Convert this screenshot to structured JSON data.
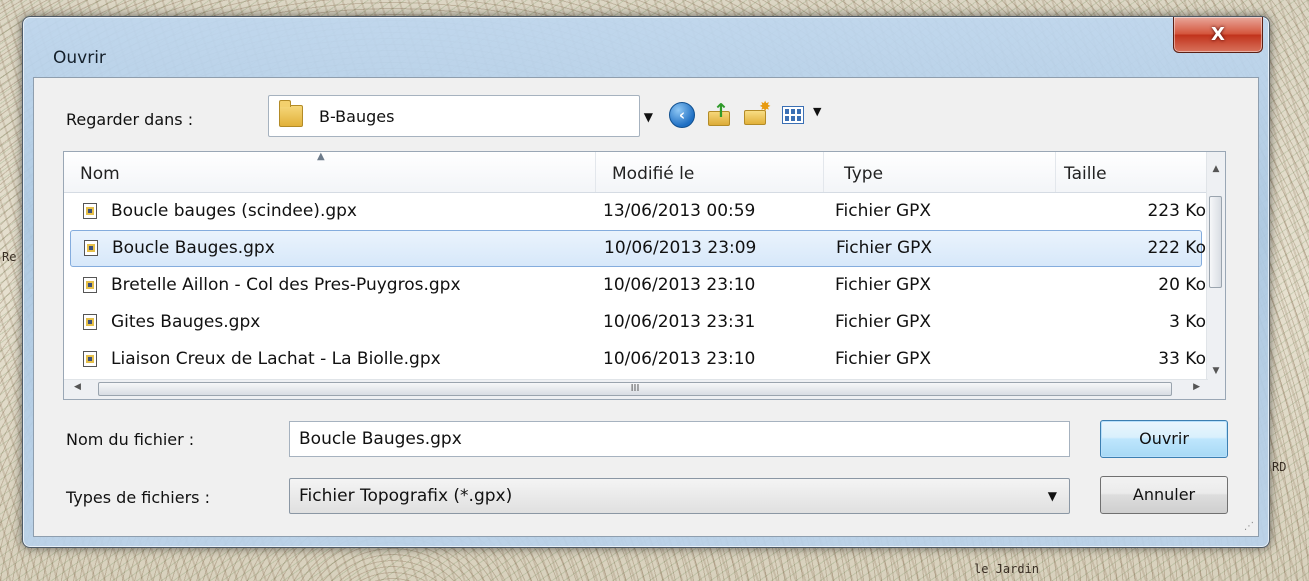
{
  "dialog": {
    "title": "Ouvrir",
    "close_label": "X"
  },
  "look_in": {
    "label": "Regarder dans :",
    "value": "B-Bauges"
  },
  "columns": {
    "name": "Nom",
    "modified": "Modifié le",
    "type": "Type",
    "size": "Taille"
  },
  "files": [
    {
      "name": "Boucle bauges (scindee).gpx",
      "modified": "13/06/2013 00:59",
      "type": "Fichier GPX",
      "size": "223 Ko",
      "selected": false
    },
    {
      "name": "Boucle Bauges.gpx",
      "modified": "10/06/2013 23:09",
      "type": "Fichier GPX",
      "size": "222 Ko",
      "selected": true
    },
    {
      "name": "Bretelle Aillon - Col des Pres-Puygros.gpx",
      "modified": "10/06/2013 23:10",
      "type": "Fichier GPX",
      "size": "20 Ko",
      "selected": false
    },
    {
      "name": "Gites Bauges.gpx",
      "modified": "10/06/2013 23:31",
      "type": "Fichier GPX",
      "size": "3 Ko",
      "selected": false
    },
    {
      "name": "Liaison Creux de Lachat - La Biolle.gpx",
      "modified": "10/06/2013 23:10",
      "type": "Fichier GPX",
      "size": "33 Ko",
      "selected": false
    }
  ],
  "filename": {
    "label": "Nom du fichier :",
    "value": "Boucle Bauges.gpx"
  },
  "filetype": {
    "label": "Types de fichiers :",
    "value": "Fichier Topografix (*.gpx)"
  },
  "buttons": {
    "open": "Ouvrir",
    "cancel": "Annuler"
  },
  "scrollbar": {
    "h_thumb_grip": "III"
  },
  "map_labels": {
    "bottom_right": "le Jardin",
    "left_edge": "Re",
    "right_edge": "RD"
  },
  "icons": {
    "back": "back-arrow-icon",
    "up": "up-folder-icon",
    "new_folder": "new-folder-icon",
    "views": "views-menu-icon",
    "file": "gpx-file-icon"
  },
  "colors": {
    "selection": "#d7e8fa",
    "selection_border": "#84acdd",
    "close_button": "#c1331c",
    "default_button_border": "#3c7fb1"
  }
}
